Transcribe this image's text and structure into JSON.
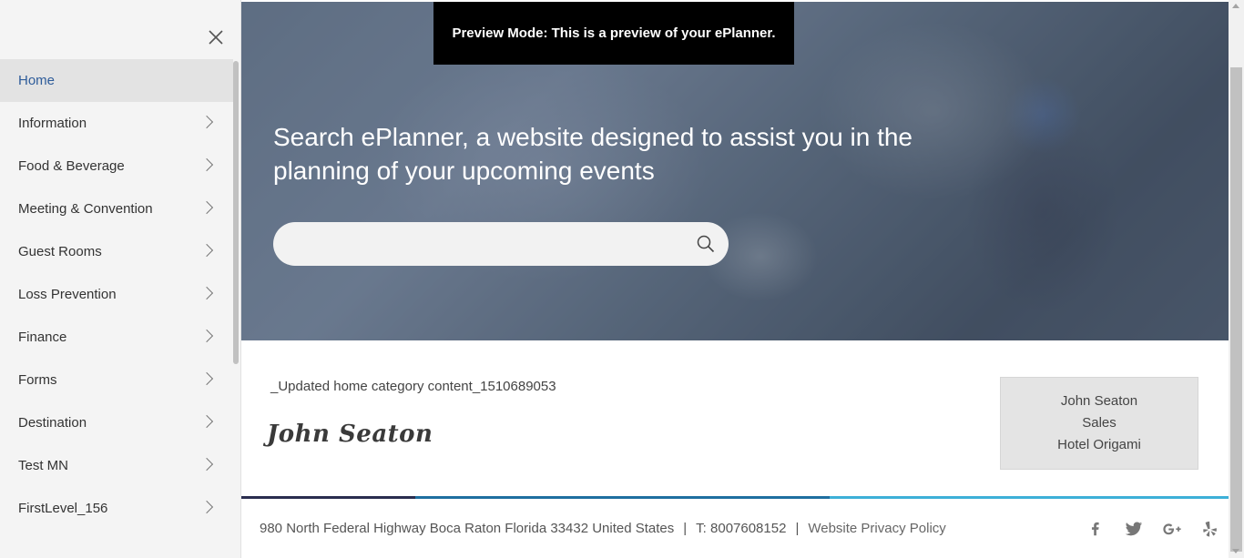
{
  "sidebar": {
    "items": [
      {
        "label": "Home",
        "active": true,
        "has_submenu": false
      },
      {
        "label": "Information",
        "active": false,
        "has_submenu": true
      },
      {
        "label": "Food & Beverage",
        "active": false,
        "has_submenu": true
      },
      {
        "label": "Meeting & Convention",
        "active": false,
        "has_submenu": true
      },
      {
        "label": "Guest Rooms",
        "active": false,
        "has_submenu": true
      },
      {
        "label": "Loss Prevention",
        "active": false,
        "has_submenu": true
      },
      {
        "label": "Finance",
        "active": false,
        "has_submenu": true
      },
      {
        "label": "Forms",
        "active": false,
        "has_submenu": true
      },
      {
        "label": "Destination",
        "active": false,
        "has_submenu": true
      },
      {
        "label": "Test MN",
        "active": false,
        "has_submenu": true
      },
      {
        "label": "FirstLevel_156",
        "active": false,
        "has_submenu": true
      }
    ],
    "close_icon": "close-icon",
    "active_color": "#2e5c9a"
  },
  "banner": {
    "text": "Preview Mode: This is a preview of your ePlanner."
  },
  "hero": {
    "title": "Search ePlanner, a website designed to assist you in the planning of your upcoming events",
    "search": {
      "value": "",
      "placeholder": "",
      "icon": "search-icon"
    }
  },
  "content": {
    "text": "_Updated home category content_1510689053",
    "signature": "John Seaton"
  },
  "contact": {
    "name": "John Seaton",
    "title": "Sales",
    "company": "Hotel Origami"
  },
  "footer": {
    "address": "980 North Federal Highway Boca Raton Florida 33432 United States",
    "separator": "|",
    "phone": "T: 8007608152",
    "privacy_link": "Website Privacy Policy",
    "socials": [
      "facebook-icon",
      "twitter-icon",
      "google-plus-icon",
      "yelp-icon"
    ],
    "colors": [
      "#2a2d4f",
      "#1f6fa0",
      "#3db0d8"
    ]
  }
}
